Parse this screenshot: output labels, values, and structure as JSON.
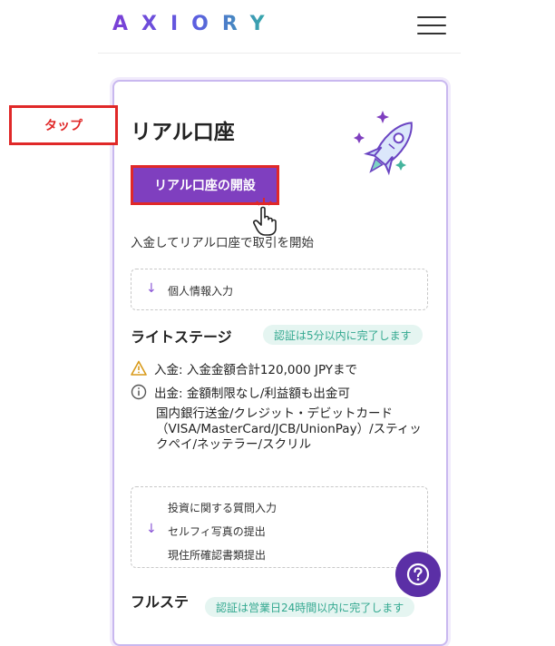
{
  "header": {
    "logo": "AXIORY",
    "menu_icon": "hamburger-menu-icon"
  },
  "card": {
    "title": "リアル口座",
    "open_button": "リアル口座の開設",
    "subtitle": "入金してリアル口座で取引を開始",
    "step1": "個人情報入力",
    "lite_stage": {
      "title": "ライトステージ",
      "badge": "認証は5分以内に完了します",
      "deposit": "入金: 入金金額合計120,000 JPYまで",
      "withdraw": "出金: 金額制限なし/利益額も出金可",
      "methods": "国内銀行送金/クレジット・デビットカード（VISA/MasterCard/JCB/UnionPay）/スティックペイ/ネッテラー/スクリル"
    },
    "step2": [
      "投資に関する質問入力",
      "セルフィ写真の提出",
      "現住所確認書類提出"
    ],
    "full_stage": {
      "title": "フルステ",
      "badge": "認証は営業日24時間以内に完了します"
    }
  },
  "annotation": {
    "callout": "タップ"
  },
  "colors": {
    "accent": "#7f3fbf",
    "callout": "#e02828",
    "badge_bg": "#e5f5f1",
    "badge_text": "#32a88f",
    "help": "#5b2fa6"
  }
}
